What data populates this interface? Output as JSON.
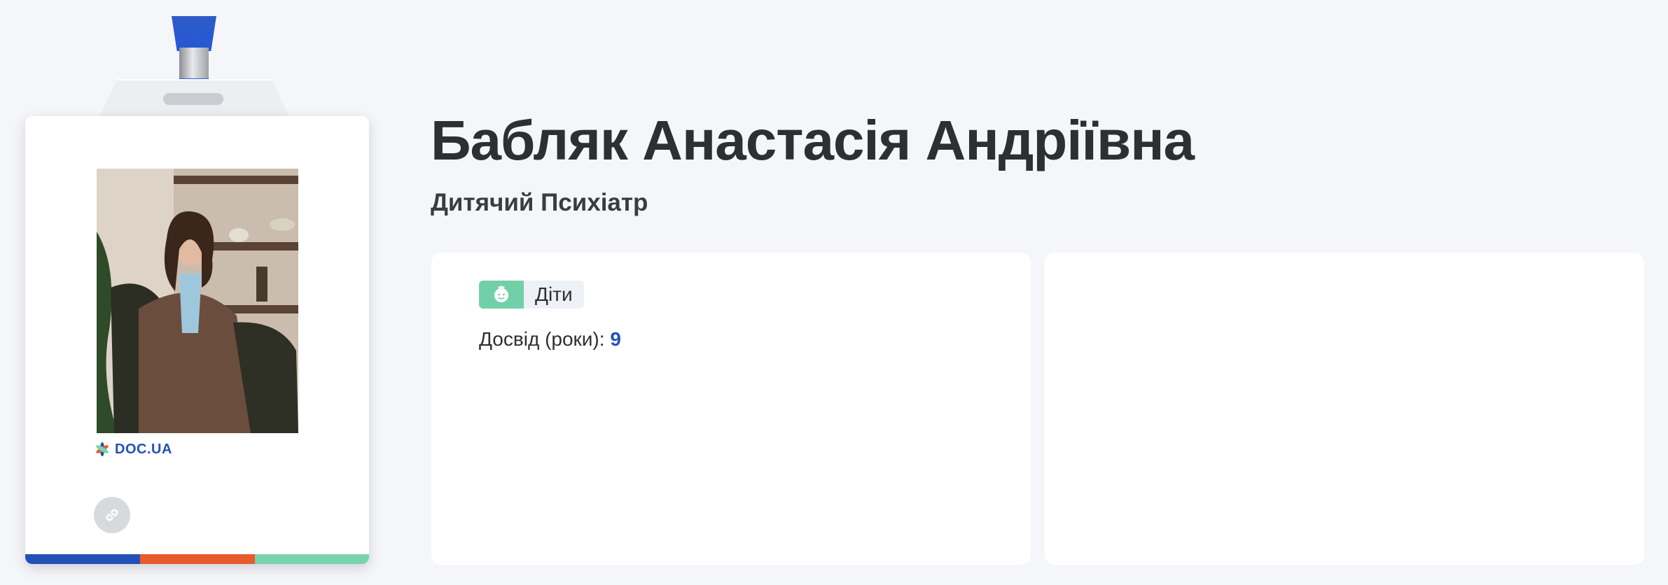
{
  "doctor": {
    "name": "Бабляк Анастасія Андріївна",
    "specialty": "Дитячий Психіатр"
  },
  "badge": {
    "brand": "DOC.UA",
    "stripe_colors": [
      "#2451b7",
      "#e85b2a",
      "#79d3ae"
    ]
  },
  "info": {
    "tag_label": "Діти",
    "tag_icon": "child-face-icon",
    "experience_label": "Досвід (роки):",
    "experience_years": "9"
  },
  "colors": {
    "accent_blue": "#2451b7",
    "tag_green": "#72d0a8",
    "background": "#f5f6f9"
  }
}
